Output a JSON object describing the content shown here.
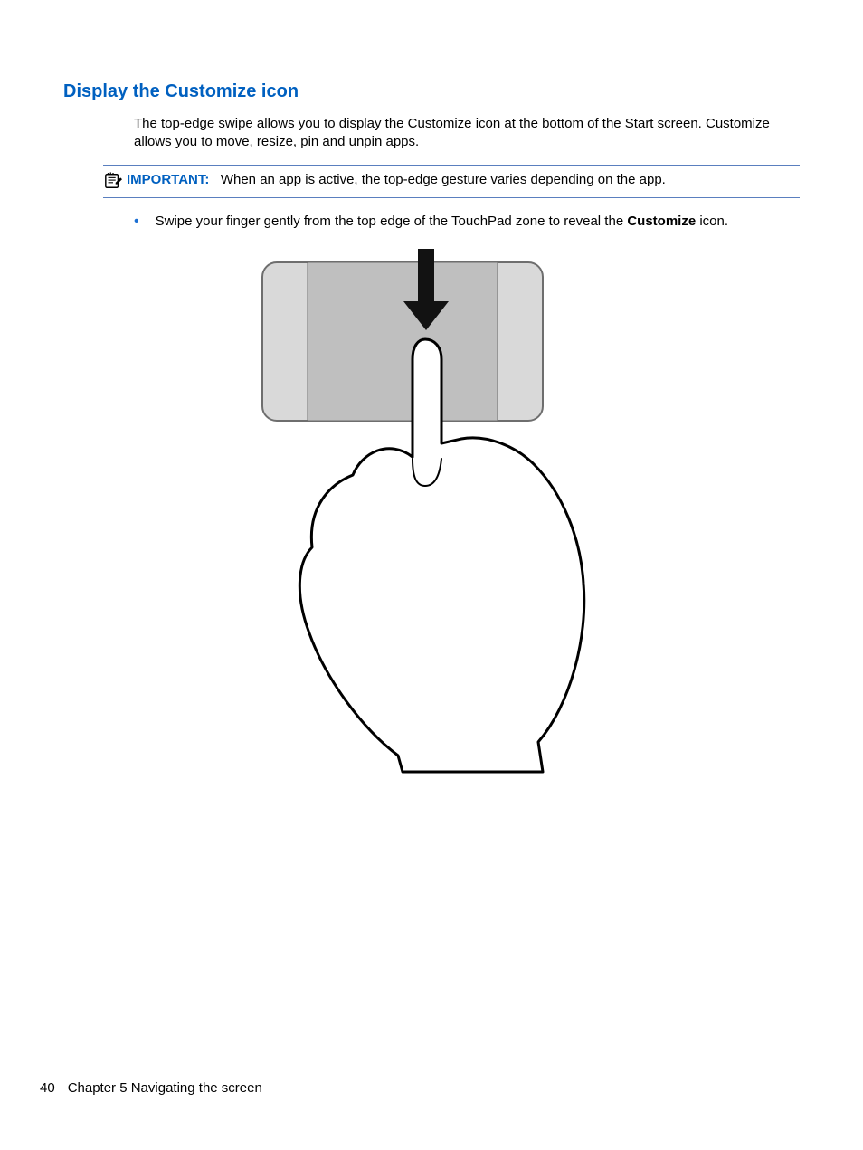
{
  "heading": "Display the Customize icon",
  "intro": "The top-edge swipe allows you to display the Customize icon at the bottom of the Start screen. Customize allows you to move, resize, pin and unpin apps.",
  "note": {
    "label": "IMPORTANT:",
    "text": "When an app is active, the top-edge gesture varies depending on the app."
  },
  "bullet": {
    "pre": "Swipe your finger gently from the top edge of the TouchPad zone to reveal the ",
    "bold": "Customize",
    "post": " icon."
  },
  "footer": {
    "page": "40",
    "chapter": "Chapter 5   Navigating the screen"
  }
}
